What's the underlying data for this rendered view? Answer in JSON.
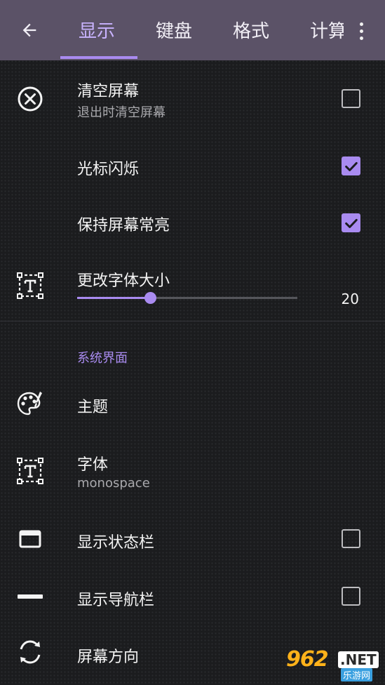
{
  "topbar": {
    "tabs": [
      {
        "label": "显示",
        "active": true
      },
      {
        "label": "键盘",
        "active": false
      },
      {
        "label": "格式",
        "active": false
      },
      {
        "label": "计算",
        "active": false
      }
    ],
    "icons": {
      "back": "arrow-left-icon",
      "more": "more-vert-icon"
    }
  },
  "settings": {
    "clear_screen": {
      "title": "清空屏幕",
      "summary": "退出时清空屏幕",
      "checked": false,
      "icon": "close-circle-icon"
    },
    "cursor_blink": {
      "title": "光标闪烁",
      "checked": true
    },
    "keep_screen_on": {
      "title": "保持屏幕常亮",
      "checked": true
    },
    "font_size": {
      "title": "更改字体大小",
      "value": "20",
      "slider_fraction": 0.33,
      "icon": "text-box-icon"
    }
  },
  "section": {
    "title": "系统界面",
    "theme": {
      "title": "主题",
      "icon": "palette-icon"
    },
    "font": {
      "title": "字体",
      "summary": "monospace",
      "icon": "text-box-icon"
    },
    "status_bar": {
      "title": "显示状态栏",
      "checked": false,
      "icon": "window-icon"
    },
    "nav_bar": {
      "title": "显示导航栏",
      "checked": false,
      "icon": "minus-bar-icon"
    },
    "orientation": {
      "title": "屏幕方向",
      "icon": "rotate-icon"
    }
  },
  "watermark": {
    "num": "962",
    "net": ".NET",
    "sub": "乐游网"
  },
  "colors": {
    "accent": "#a98bf0",
    "topbar": "#5b5267",
    "background": "#1b1c1e"
  }
}
